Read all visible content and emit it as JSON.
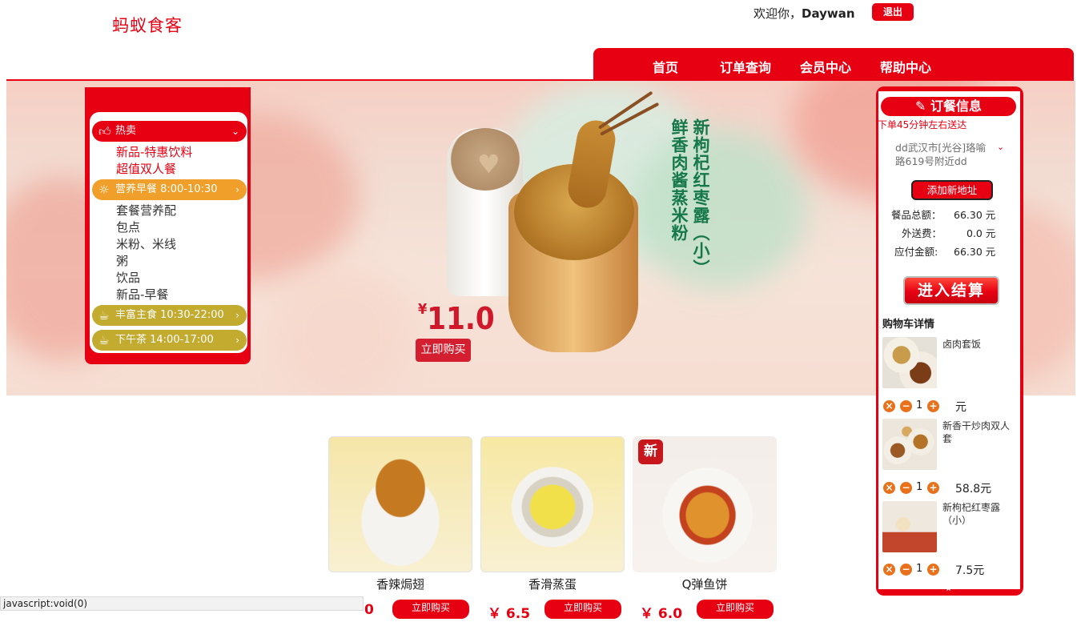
{
  "header": {
    "logo": "蚂蚁食客",
    "welcome_prefix": "欢迎你，",
    "username": "Daywan",
    "logout": "退出"
  },
  "nav": [
    "首页",
    "订单查询",
    "会员中心",
    "帮助中心"
  ],
  "banner": {
    "price_symbol": "¥",
    "price": "11.0",
    "buy_label": "立即购买",
    "vtext_1": "新枸杞红枣露（小）",
    "vtext_2": "鲜香肉酱蒸米粉"
  },
  "menu": {
    "groups": [
      {
        "title": "热卖",
        "items": [
          "新品-特惠饮料",
          "超值双人餐"
        ],
        "color": "#e60012"
      },
      {
        "title": "营养早餐 8:00-10:30",
        "items": [
          "套餐营养配",
          "包点",
          "米粉、米线",
          "粥",
          "饮品",
          "新品-早餐"
        ],
        "color": "#f0a02a"
      },
      {
        "title": "丰富主食 10:30-22:00",
        "items": [],
        "color": "#c2ab2e"
      },
      {
        "title": "下午茶 14:00-17:00",
        "items": [],
        "color": "#c2ab2e"
      }
    ]
  },
  "order": {
    "title": "订餐信息",
    "delivery_note": "下单45分钟左右送达",
    "address": "dd武汉市[光谷]珞喻路619号附近dd",
    "add_address": "添加新地址",
    "total_label": "餐品总额：",
    "total_value": "66.30 元",
    "fee_label": "外送费：",
    "fee_value": "0.0 元",
    "pay_label": "应付金额:",
    "pay_value": "66.30 元",
    "checkout": "进入结算",
    "cart_title": "购物车详情"
  },
  "cart": [
    {
      "name": "卤肉套饭",
      "qty": "1",
      "price": "元"
    },
    {
      "name": "新香干炒肉双人套",
      "qty": "1",
      "price": "58.8元"
    },
    {
      "name": "新枸杞红枣露（小）",
      "qty": "1",
      "price": "7.5元"
    }
  ],
  "products": [
    {
      "name": "香辣焗翅",
      "price": "0",
      "buy": "立即购买"
    },
    {
      "name": "香滑蒸蛋",
      "price": "￥ 6.5",
      "buy": "立即购买"
    },
    {
      "name": "Q弹鱼饼",
      "price": "￥ 6.0",
      "buy": "立即购买"
    }
  ],
  "new_badge": "新",
  "status_bar": "javascript:void(0)"
}
